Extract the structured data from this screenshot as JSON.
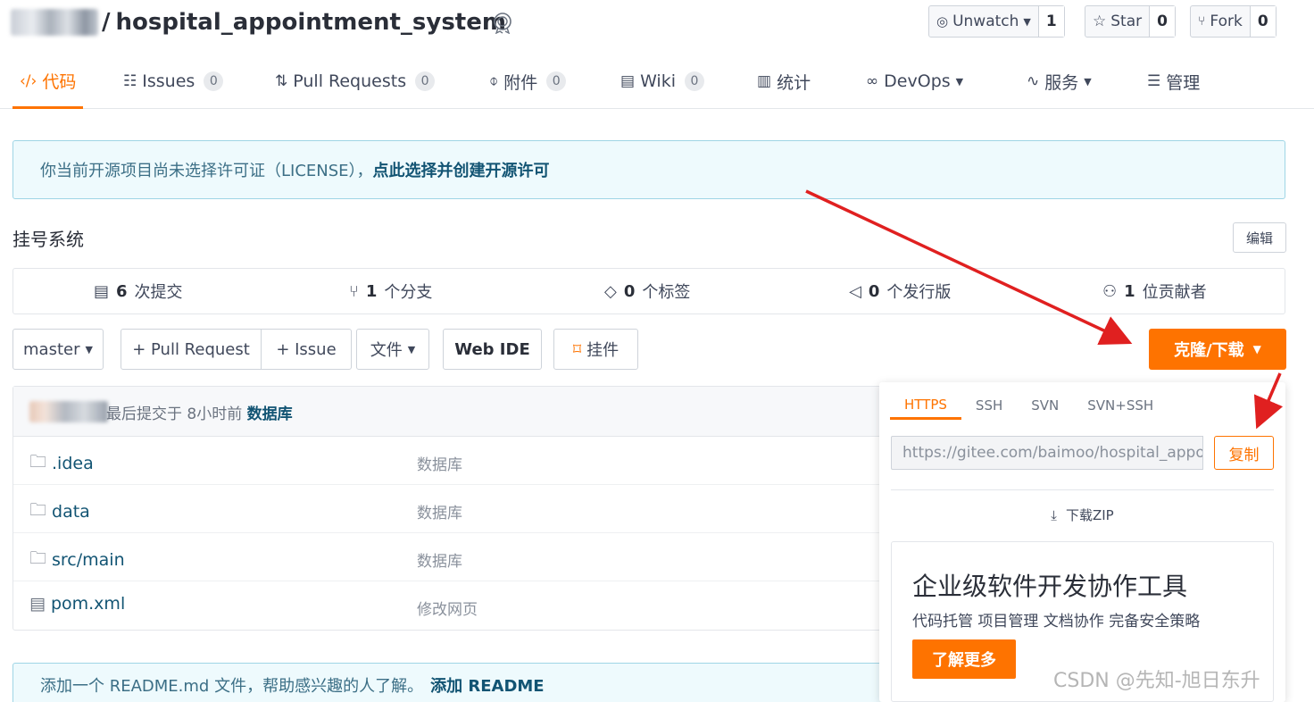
{
  "repo": {
    "owner_label": "",
    "slash": "/",
    "name": "hospital_appointment_system"
  },
  "header_buttons": {
    "unwatch": {
      "label": "Unwatch",
      "count": "1"
    },
    "star": {
      "label": "Star",
      "count": "0"
    },
    "fork": {
      "label": "Fork",
      "count": "0"
    }
  },
  "tabs": [
    {
      "icon": "code-icon",
      "label": "代码",
      "count": ""
    },
    {
      "icon": "issues-icon",
      "label": "Issues",
      "count": "0"
    },
    {
      "icon": "pull-request-icon",
      "label": "Pull Requests",
      "count": "0"
    },
    {
      "icon": "attachment-icon",
      "label": "附件",
      "count": "0"
    },
    {
      "icon": "wiki-icon",
      "label": "Wiki",
      "count": "0"
    },
    {
      "icon": "stats-icon",
      "label": "统计",
      "count": ""
    },
    {
      "icon": "devops-icon",
      "label": "DevOps",
      "count": ""
    },
    {
      "icon": "service-icon",
      "label": "服务",
      "count": ""
    },
    {
      "icon": "manage-icon",
      "label": "管理",
      "count": ""
    }
  ],
  "license": {
    "text": "你当前开源项目尚未选择许可证（LICENSE），",
    "link": "点此选择并创建开源许可"
  },
  "description": "挂号系统",
  "edit_label": "编辑",
  "stats": [
    {
      "icon": "commit-icon",
      "count": "6",
      "label": "次提交"
    },
    {
      "icon": "branch-icon",
      "count": "1",
      "label": "个分支"
    },
    {
      "icon": "tag-icon",
      "count": "0",
      "label": "个标签"
    },
    {
      "icon": "release-icon",
      "count": "0",
      "label": "个发行版"
    },
    {
      "icon": "contributor-icon",
      "count": "1",
      "label": "位贡献者"
    }
  ],
  "toolbar": {
    "branch": "master",
    "pull_request": "+ Pull Request",
    "issue": "+ Issue",
    "file": "文件",
    "web_ide": "Web IDE",
    "bookmark": "挂件",
    "clone": "克隆/下载"
  },
  "commit": {
    "text": "最后提交于 8小时前",
    "message": "数据库"
  },
  "files": [
    {
      "type": "folder",
      "name": ".idea",
      "message": "数据库"
    },
    {
      "type": "folder",
      "name": "data",
      "message": "数据库"
    },
    {
      "type": "folder",
      "name": "src/main",
      "message": "数据库"
    },
    {
      "type": "file",
      "name": "pom.xml",
      "message": "修改网页"
    }
  ],
  "readme": {
    "text": "添加一个 README.md 文件，帮助感兴趣的人了解。",
    "link": "添加 README"
  },
  "clone_panel": {
    "protocols": [
      "HTTPS",
      "SSH",
      "SVN",
      "SVN+SSH"
    ],
    "active_protocol": "HTTPS",
    "url": "https://gitee.com/baimoo/hospital_appointment_system.git",
    "copy_label": "复制",
    "download_zip": "下载ZIP",
    "ad_title": "企业级软件开发协作工具",
    "ad_subtitle": "代码托管 项目管理 文档协作 完备安全策略",
    "ad_button": "了解更多"
  },
  "watermark": "CSDN @先知-旭日东升",
  "colors": {
    "accent": "#fe7300",
    "link": "#125473",
    "info_bg": "#eefafd",
    "annotation_arrow": "#e02020"
  }
}
